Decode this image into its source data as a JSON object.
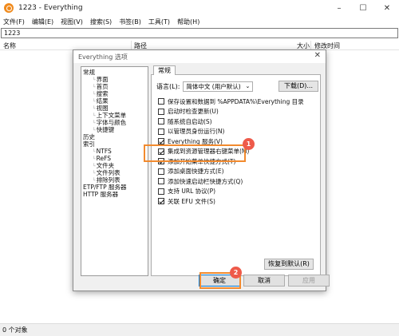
{
  "window": {
    "title": "1223 - Everything"
  },
  "menu": [
    "文件(F)",
    "编辑(E)",
    "视图(V)",
    "搜索(S)",
    "书签(B)",
    "工具(T)",
    "帮助(H)"
  ],
  "search": {
    "value": "1223"
  },
  "columns": {
    "name": "名称",
    "path": "路径",
    "size": "大小",
    "modified": "修改时间"
  },
  "status": {
    "text": "0 个对象"
  },
  "dialog": {
    "title": "Everything 选项",
    "tree": [
      {
        "label": "常规",
        "level": 1
      },
      {
        "label": "界面",
        "level": 2
      },
      {
        "label": "首页",
        "level": 2
      },
      {
        "label": "搜索",
        "level": 2
      },
      {
        "label": "结果",
        "level": 2
      },
      {
        "label": "视图",
        "level": 2
      },
      {
        "label": "上下文菜单",
        "level": 2
      },
      {
        "label": "字体与颜色",
        "level": 2
      },
      {
        "label": "快捷键",
        "level": 2
      },
      {
        "label": "历史",
        "level": 1
      },
      {
        "label": "索引",
        "level": 1
      },
      {
        "label": "NTFS",
        "level": 2
      },
      {
        "label": "ReFS",
        "level": 2
      },
      {
        "label": "文件夹",
        "level": 2
      },
      {
        "label": "文件列表",
        "level": 2
      },
      {
        "label": "排除列表",
        "level": 2
      },
      {
        "label": "ETP/FTP 服务器",
        "level": 1
      },
      {
        "label": "HTTP 服务器",
        "level": 1
      }
    ],
    "tab": "常规",
    "language_label": "语言(L):",
    "language_value": "简体中文 (用户默认)",
    "download_btn": "下载(D)...",
    "options": [
      {
        "label": "保存设置和数据到 %APPDATA%\\Everything 目录",
        "checked": false
      },
      {
        "label": "启动时检查更新(U)",
        "checked": false
      },
      {
        "label": "随系统自启动(S)",
        "checked": false
      },
      {
        "label": "以管理员身份运行(N)",
        "checked": false
      },
      {
        "label": "Everything 服务(V)",
        "checked": true
      },
      {
        "label": "集成到资源管理器右键菜单(M)",
        "checked": true
      },
      {
        "label": "添加开始菜单快捷方式(T)",
        "checked": true
      },
      {
        "label": "添加桌面快捷方式(E)",
        "checked": false
      },
      {
        "label": "添加快速启动栏快捷方式(Q)",
        "checked": false
      },
      {
        "label": "支持 URL 协议(P)",
        "checked": false
      },
      {
        "label": "关联 EFU 文件(S)",
        "checked": true
      }
    ],
    "restore_btn": "恢复到默认(R)",
    "ok_btn": "确定",
    "cancel_btn": "取消",
    "apply_btn": "应用"
  },
  "annotations": {
    "badge1": "1",
    "badge2": "2"
  },
  "colors": {
    "highlight": "#f28a2e",
    "badge": "#ee5a4a",
    "app_icon": "#f08a1c"
  }
}
